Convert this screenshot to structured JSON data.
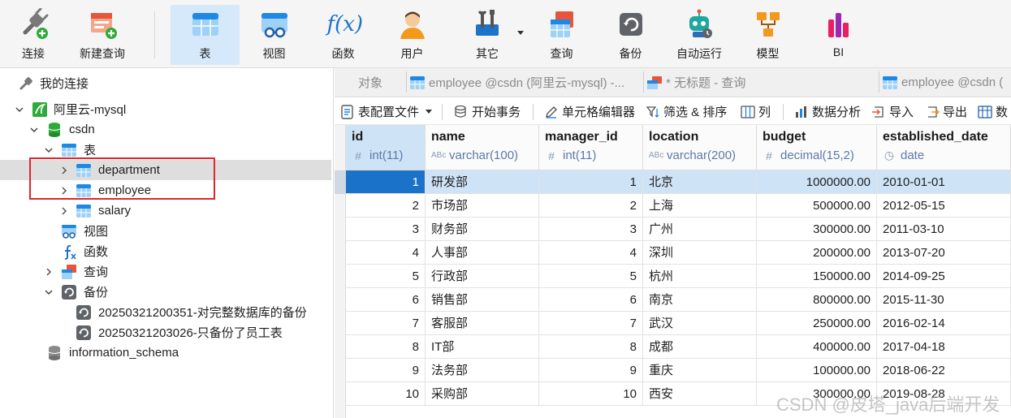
{
  "toolbar": {
    "connect": "连接",
    "new_query": "新建查询",
    "table": "表",
    "view": "视图",
    "function": "函数",
    "user": "用户",
    "other": "其它",
    "query": "查询",
    "backup": "备份",
    "automation": "自动运行",
    "model": "模型",
    "bi": "BI",
    "function_glyph": "f(x)"
  },
  "tree": {
    "root": "我的连接",
    "connection": "阿里云-mysql",
    "database": "csdn",
    "tables_group": "表",
    "tables": [
      "department",
      "employee",
      "salary"
    ],
    "views": "视图",
    "functions": "函数",
    "queries": "查询",
    "backups": "备份",
    "backup_items": [
      "20250321200351-对完整数据库的备份",
      "20250321203026-只备份了员工表"
    ],
    "other_db": "information_schema"
  },
  "tabs": {
    "objects": "对象",
    "tab1": "employee @csdn (阿里云-mysql) -...",
    "tab2": "* 无标题 - 查询",
    "tab3": "employee @csdn ("
  },
  "objbar": {
    "table_config": "表配置文件",
    "begin_tx": "开始事务",
    "cell_editor": "单元格编辑器",
    "filter_sort": "筛选 & 排序",
    "columns": "列",
    "data_analysis": "数据分析",
    "import": "导入",
    "export": "导出",
    "data_truncated": "数"
  },
  "columns": [
    {
      "name": "id",
      "type": "int(11)",
      "glyph": "#"
    },
    {
      "name": "name",
      "type": "varchar(100)",
      "glyph": "ABc"
    },
    {
      "name": "manager_id",
      "type": "int(11)",
      "glyph": "#"
    },
    {
      "name": "location",
      "type": "varchar(200)",
      "glyph": "ABc"
    },
    {
      "name": "budget",
      "type": "decimal(15,2)",
      "glyph": "#"
    },
    {
      "name": "established_date",
      "type": "date",
      "glyph": "◷"
    }
  ],
  "rows": [
    [
      "1",
      "研发部",
      "1",
      "北京",
      "1000000.00",
      "2010-01-01"
    ],
    [
      "2",
      "市场部",
      "2",
      "上海",
      "500000.00",
      "2012-05-15"
    ],
    [
      "3",
      "财务部",
      "3",
      "广州",
      "300000.00",
      "2011-03-10"
    ],
    [
      "4",
      "人事部",
      "4",
      "深圳",
      "200000.00",
      "2013-07-20"
    ],
    [
      "5",
      "行政部",
      "5",
      "杭州",
      "150000.00",
      "2014-09-25"
    ],
    [
      "6",
      "销售部",
      "6",
      "南京",
      "800000.00",
      "2015-11-30"
    ],
    [
      "7",
      "客服部",
      "7",
      "武汉",
      "250000.00",
      "2016-02-14"
    ],
    [
      "8",
      "IT部",
      "8",
      "成都",
      "400000.00",
      "2017-04-18"
    ],
    [
      "9",
      "法务部",
      "9",
      "重庆",
      "100000.00",
      "2018-06-22"
    ],
    [
      "10",
      "采购部",
      "10",
      "西安",
      "300000.00",
      "2019-08-28"
    ]
  ],
  "watermark": "CSDN @皮塔_java后端开发",
  "colors": {
    "accent": "#1a73c8",
    "selection": "#cfe3f7",
    "highlight_border": "#e0262c",
    "type_text": "#5b7aa8"
  }
}
